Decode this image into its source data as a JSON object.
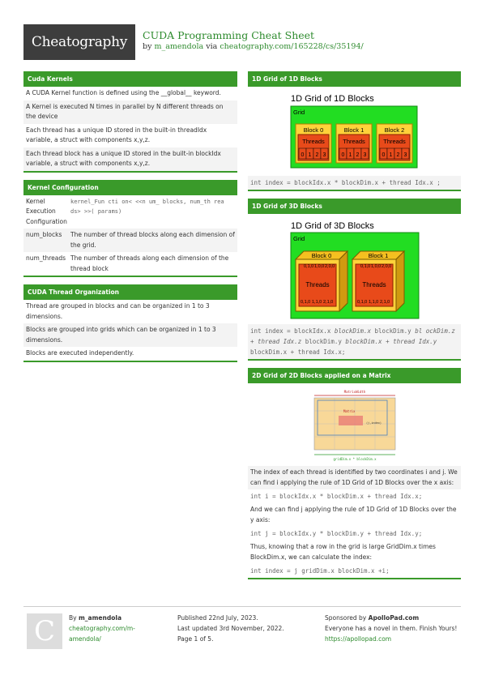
{
  "header": {
    "logo": "Cheatography",
    "title": "CUDA Programming Cheat Sheet",
    "by": "by",
    "author": "m_amendola",
    "via": "via",
    "url": "cheatography.com/165228/cs/35194/"
  },
  "cuda_kernels": {
    "heading": "Cuda Kernels",
    "items": [
      "A CUDA Kernel function is defined using the __global__ keyword.",
      "A Kernel is executed N times in parallel by N different threads on the device",
      "Each thread has a unique ID stored in the built-in threadIdx variable, a struct with components x,y,z.",
      "Each thread block has a unique ID stored in the built-in blockIdx variable, a struct with components x,y,z."
    ]
  },
  "kernel_config": {
    "heading": "Kernel Configuration",
    "rows": [
      {
        "k": "Kernel Execution Configuration",
        "v": "kernel_Fun cti on< <<n um_ blocks, num_th rea ds> >>( params)"
      },
      {
        "k": "num_blocks",
        "v": "The number of thread blocks along each dimension of the grid."
      },
      {
        "k": "num_threads",
        "v": "The number of threads along each dimension of the thread block"
      }
    ]
  },
  "thread_org": {
    "heading": "CUDA Thread Organization",
    "items": [
      "Thread are grouped in blocks and can be organized in 1 to 3 dimensions.",
      "Blocks are grouped into grids which can be organized in 1 to 3 dimensions.",
      "Blocks are executed independently."
    ]
  },
  "grid1d": {
    "heading": "1D Grid of 1D Blocks",
    "diagram_title": "1D Grid of 1D Blocks",
    "grid_label": "Grid",
    "blocks": [
      "Block 0",
      "Block 1",
      "Block 2"
    ],
    "threads_label": "Threads",
    "thread_ids": [
      "0",
      "1",
      "2",
      "3"
    ],
    "code": "int index = blockIdx.x * blockDim.x + thread Idx.x ;"
  },
  "grid3d": {
    "heading": "1D Grid of 3D Blocks",
    "diagram_title": "1D Grid of 3D Blocks",
    "grid_label": "Grid",
    "blocks": [
      "Block 0",
      "Block 1"
    ],
    "threads_label": "Threads",
    "top_ids": [
      "0,1,0",
      "1,0,0",
      "2,0,0"
    ],
    "bottom_ids": [
      "0,1,0",
      "1,1,0",
      "2,1,0"
    ],
    "code_a": "int index = blockIdx.x ",
    "code_b": "blockDim.x ",
    "code_c": "blockDim.y ",
    "code_d": "bl ockDim.z + thread Idx.z ",
    "code_e": "blockDim.y ",
    "code_f": "blockDim.x + thread Idx.y ",
    "code_g": "blockDim.x + thread Idx.x;"
  },
  "matrix": {
    "heading": "2D Grid of 2D Blocks applied on a Matrix",
    "top_label": "MatrixWidth",
    "bottom_label": "gridDim.x * blockDim.x",
    "inner_label": "Matrix",
    "index_label": "(j,index)",
    "lines": [
      {
        "t": "text",
        "v": "The index of each thread is identified by two coordinates i and j. We can find i applying the rule of 1D Grid of 1D Blocks over the x axis:"
      },
      {
        "t": "code",
        "v": "int i = blockIdx.x * blockDim.x + thread Idx.x;"
      },
      {
        "t": "text",
        "v": "And we can find j applying the rule of 1D Grid of 1D Blocks over the y axis:"
      },
      {
        "t": "code",
        "v": "int j = blockIdx.y * blockDim.y + thread Idx.y;"
      },
      {
        "t": "text",
        "v": "Thus, knowing that a row in the grid is large GridDim.x times BlockDim.x, we can calculate the index:"
      },
      {
        "t": "code",
        "v": "int index = j gridDim.x  blockDim.x +i;"
      }
    ]
  },
  "footer": {
    "badge": "C",
    "by": "By",
    "author": "m_amendola",
    "author_url": "cheatography.com/m-amendola/",
    "published": "Published 22nd July, 2023.",
    "updated": "Last updated 3rd November, 2022.",
    "page": "Page 1 of 5.",
    "sponsored": "Sponsored by",
    "sponsor": "ApolloPad.com",
    "tagline": "Everyone has a novel in them. Finish Yours!",
    "sponsor_url": "https://apollopad.com"
  }
}
